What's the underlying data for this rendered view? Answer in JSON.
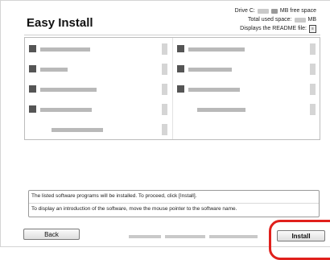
{
  "header": {
    "title": "Easy Install",
    "drive_label": "Drive C:",
    "free_space_label": "MB free space",
    "total_used_label": "Total used space:",
    "total_used_unit": "MB",
    "readme_label": "Displays the README file:"
  },
  "software_list": {
    "left_column_items": 5,
    "right_column_items": 4
  },
  "message": {
    "line1": "The listed software programs will be installed. To proceed, click [Install].",
    "line2": "To display an introduction of the software, move the mouse pointer to the software name."
  },
  "buttons": {
    "back": "Back",
    "install": "Install"
  },
  "colors": {
    "highlight": "#e0201c"
  }
}
